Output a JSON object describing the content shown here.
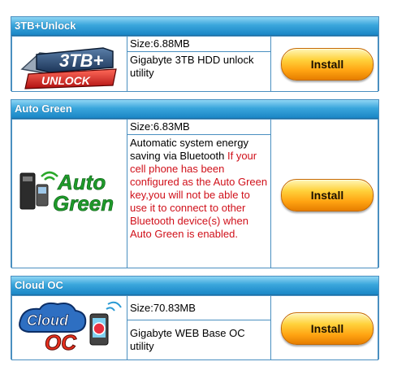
{
  "apps": [
    {
      "title": "3TB+Unlock",
      "size": "Size:6.88MB",
      "description": "Gigabyte 3TB HDD unlock utility",
      "logo_text_top": "3TB+",
      "logo_text_bottom": "UNLOCK",
      "install_label": "Install"
    },
    {
      "title": "Auto Green",
      "size": "Size:6.83MB",
      "description": "Automatic system energy saving via Bluetooth",
      "warning": "If your cell phone has been configured as the Auto Green key,you will not be able to use it to connect to other Bluetooth device(s) when Auto Green is enabled.",
      "logo_text_top": "Auto",
      "logo_text_bottom": "Green",
      "install_label": "Install"
    },
    {
      "title": "Cloud OC",
      "size": "Size:70.83MB",
      "description": "Gigabyte WEB Base OC utility",
      "logo_text_top": "Cloud",
      "logo_text_bottom": "OC",
      "install_label": "Install"
    }
  ],
  "colors": {
    "header_blue": "#2a97d4",
    "border_blue": "#4a8fc0",
    "warning_red": "#d0101a",
    "button_orange": "#ffa412"
  }
}
